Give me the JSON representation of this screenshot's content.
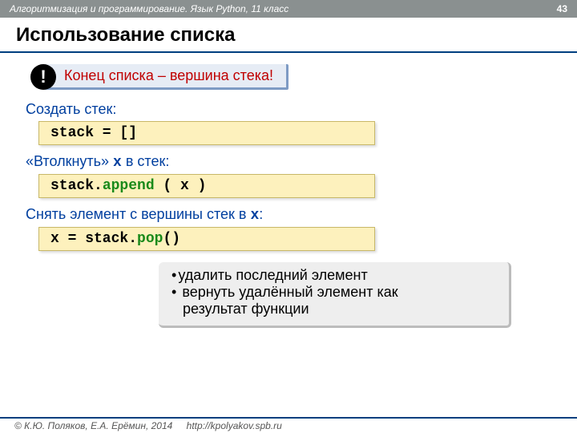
{
  "header": {
    "course": "Алгоритмизация и программирование. Язык Python, 11 класс",
    "page": "43"
  },
  "title": "Использование списка",
  "callout": {
    "badge": "!",
    "text": "Конец списка – вершина стека!"
  },
  "sections": {
    "create": {
      "label_pre": "Создать стек:",
      "code": "stack = []"
    },
    "push": {
      "label_pre": "«Втолкнуть» ",
      "label_mono": "x",
      "label_post": " в стек:",
      "code_pre": "stack.",
      "code_method": "append",
      "code_post": " ( x )"
    },
    "pop": {
      "label_pre": "Снять элемент с вершины стек в ",
      "label_mono": "x",
      "label_post": ":",
      "code_pre": "x = stack.",
      "code_method": "pop",
      "code_post": "()"
    }
  },
  "note": {
    "item1": "удалить последний элемент",
    "item2a": "вернуть удалённый элемент как",
    "item2b": "результат функции"
  },
  "footer": {
    "copyright": "© К.Ю. Поляков, Е.А. Ерёмин, 2014",
    "url": "http://kpolyakov.spb.ru"
  }
}
